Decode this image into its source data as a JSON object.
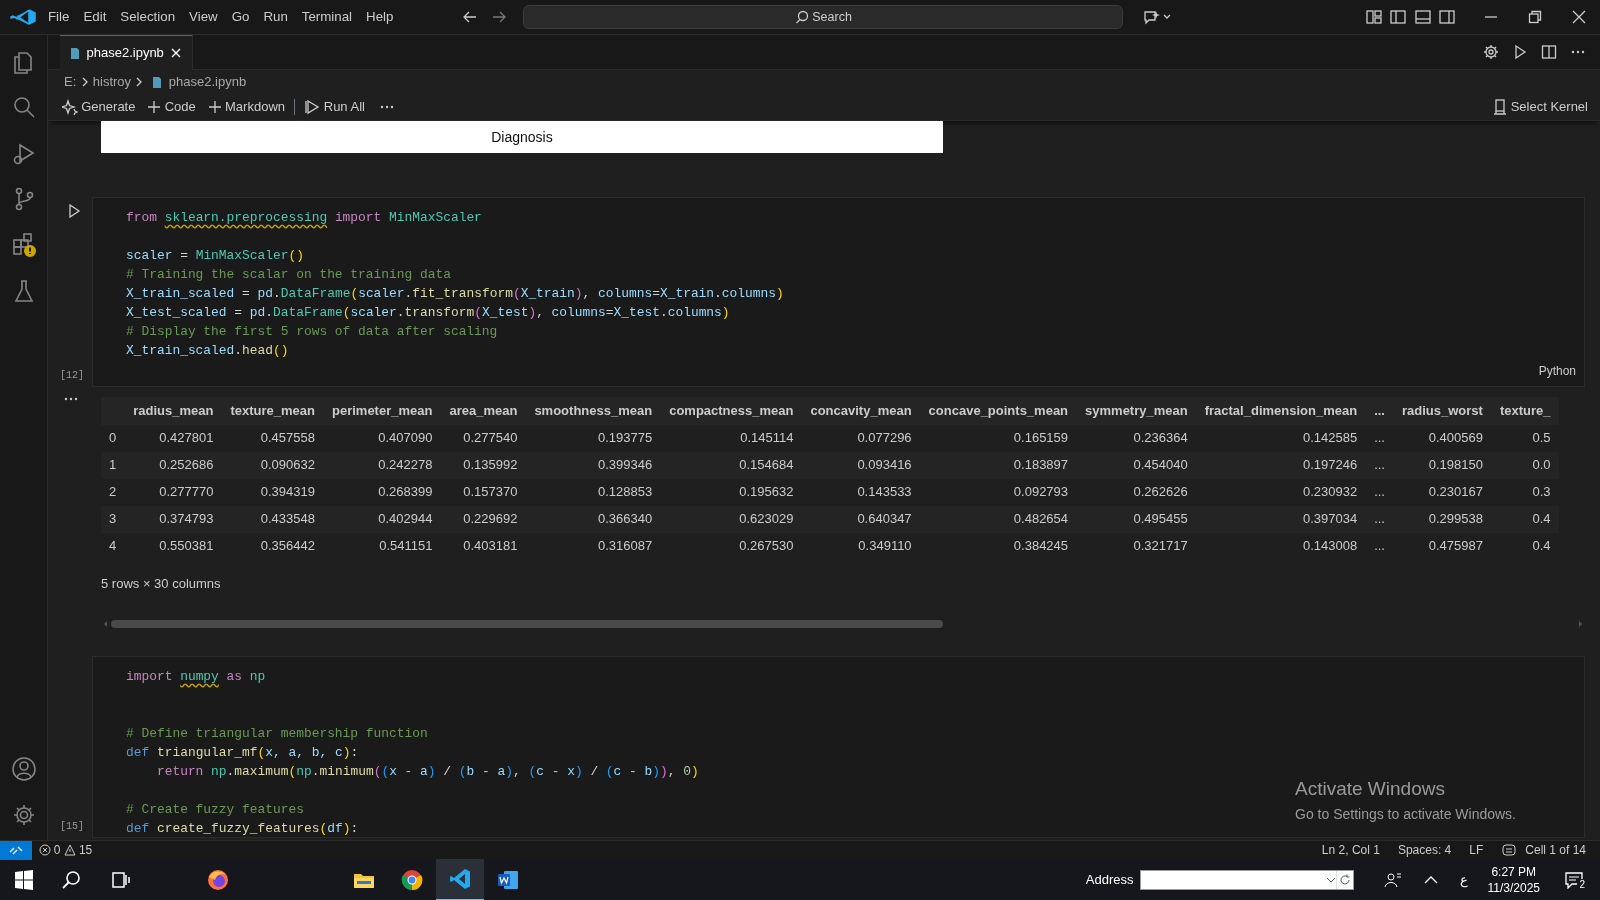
{
  "menu": [
    "File",
    "Edit",
    "Selection",
    "View",
    "Go",
    "Run",
    "Terminal",
    "Help"
  ],
  "search": {
    "placeholder": "Search"
  },
  "editor_tabs": [
    {
      "label": "phase2.ipynb",
      "selected": true
    }
  ],
  "breadcrumb": [
    "E:",
    "histroy",
    "phase2.ipynb"
  ],
  "notebook_toolbar": [
    {
      "label": "Generate",
      "kind": "sparkle"
    },
    {
      "label": "Code",
      "kind": "plus"
    },
    {
      "label": "Markdown",
      "kind": "plus"
    },
    {
      "label": "Run All",
      "kind": "run"
    }
  ],
  "kernel": {
    "label": "Select Kernel"
  },
  "plot_fragment": {
    "label": "Diagnosis"
  },
  "cells": [
    {
      "execution_count": "[12]",
      "language": "Python",
      "lines": [
        {
          "segments": [
            {
              "t": "from ",
              "kind": "keyword"
            },
            {
              "t": "sklearn.preprocessing",
              "kind": "module",
              "squiggle": true
            },
            {
              "t": " import ",
              "kind": "keyword"
            },
            {
              "t": "MinMaxScaler",
              "kind": "module"
            }
          ]
        },
        {
          "kind": "spaced",
          "segments": [
            {
              "t": "scaler",
              "kind": "variable"
            },
            {
              "t": " = ",
              "kind": "plain"
            },
            {
              "t": "MinMaxScaler",
              "kind": "module"
            },
            {
              "t": "()",
              "kind": "bracket"
            }
          ]
        },
        {
          "segments": [
            {
              "t": "# Training the scalar on the training data",
              "kind": "comment"
            }
          ]
        },
        {
          "segments": [
            {
              "t": "X_train_scaled",
              "kind": "variable"
            },
            {
              "t": " = ",
              "kind": "plain"
            },
            {
              "t": "pd",
              "kind": "variable"
            },
            {
              "t": ".",
              "kind": "plain"
            },
            {
              "t": "DataFrame",
              "kind": "module"
            },
            {
              "t": "(",
              "kind": "bracket"
            },
            {
              "t": "scaler",
              "kind": "variable"
            },
            {
              "t": ".",
              "kind": "plain"
            },
            {
              "t": "fit_transform",
              "kind": "function"
            },
            {
              "t": "(",
              "kind": "bracket2"
            },
            {
              "t": "X_train",
              "kind": "variable"
            },
            {
              "t": ")",
              "kind": "bracket2"
            },
            {
              "t": ", ",
              "kind": "plain"
            },
            {
              "t": "columns",
              "kind": "variable"
            },
            {
              "t": "=",
              "kind": "plain"
            },
            {
              "t": "X_train",
              "kind": "variable"
            },
            {
              "t": ".",
              "kind": "plain"
            },
            {
              "t": "columns",
              "kind": "variable"
            },
            {
              "t": ")",
              "kind": "bracket"
            }
          ]
        },
        {
          "segments": [
            {
              "t": "X_test_scaled",
              "kind": "variable"
            },
            {
              "t": " = ",
              "kind": "plain"
            },
            {
              "t": "pd",
              "kind": "variable"
            },
            {
              "t": ".",
              "kind": "plain"
            },
            {
              "t": "DataFrame",
              "kind": "module"
            },
            {
              "t": "(",
              "kind": "bracket"
            },
            {
              "t": "scaler",
              "kind": "variable"
            },
            {
              "t": ".",
              "kind": "plain"
            },
            {
              "t": "transform",
              "kind": "function"
            },
            {
              "t": "(",
              "kind": "bracket2"
            },
            {
              "t": "X_test",
              "kind": "variable"
            },
            {
              "t": ")",
              "kind": "bracket2"
            },
            {
              "t": ", ",
              "kind": "plain"
            },
            {
              "t": "columns",
              "kind": "variable"
            },
            {
              "t": "=",
              "kind": "plain"
            },
            {
              "t": "X_test",
              "kind": "variable"
            },
            {
              "t": ".",
              "kind": "plain"
            },
            {
              "t": "columns",
              "kind": "variable"
            },
            {
              "t": ")",
              "kind": "bracket"
            }
          ]
        },
        {
          "segments": [
            {
              "t": "# Display the first 5 rows of data after scaling",
              "kind": "comment"
            }
          ]
        },
        {
          "segments": [
            {
              "t": "X_train_scaled",
              "kind": "variable"
            },
            {
              "t": ".",
              "kind": "plain"
            },
            {
              "t": "head",
              "kind": "function"
            },
            {
              "t": "()",
              "kind": "bracket"
            }
          ]
        }
      ],
      "output": {
        "columns": [
          "radius_mean",
          "texture_mean",
          "perimeter_mean",
          "area_mean",
          "smoothness_mean",
          "compactness_mean",
          "concavity_mean",
          "concave_points_mean",
          "symmetry_mean",
          "fractal_dimension_mean",
          "...",
          "radius_worst",
          "texture_"
        ],
        "rows": [
          {
            "index": "0",
            "cells": [
              "0.427801",
              "0.457558",
              "0.407090",
              "0.277540",
              "0.193775",
              "0.145114",
              "0.077296",
              "0.165159",
              "0.236364",
              "0.142585",
              "...",
              "0.400569",
              "0.5"
            ]
          },
          {
            "index": "1",
            "cells": [
              "0.252686",
              "0.090632",
              "0.242278",
              "0.135992",
              "0.399346",
              "0.154684",
              "0.093416",
              "0.183897",
              "0.454040",
              "0.197246",
              "...",
              "0.198150",
              "0.0"
            ]
          },
          {
            "index": "2",
            "cells": [
              "0.277770",
              "0.394319",
              "0.268399",
              "0.157370",
              "0.128853",
              "0.195632",
              "0.143533",
              "0.092793",
              "0.262626",
              "0.230932",
              "...",
              "0.230167",
              "0.3"
            ]
          },
          {
            "index": "3",
            "cells": [
              "0.374793",
              "0.433548",
              "0.402944",
              "0.229692",
              "0.366340",
              "0.623029",
              "0.640347",
              "0.482654",
              "0.495455",
              "0.397034",
              "...",
              "0.299538",
              "0.4"
            ]
          },
          {
            "index": "4",
            "cells": [
              "0.550381",
              "0.356442",
              "0.541151",
              "0.403181",
              "0.316087",
              "0.267530",
              "0.349110",
              "0.384245",
              "0.321717",
              "0.143008",
              "...",
              "0.475987",
              "0.4"
            ]
          }
        ],
        "summary": "5 rows × 30 columns"
      }
    },
    {
      "execution_count": "[15]",
      "lines": [
        {
          "segments": [
            {
              "t": "import ",
              "kind": "keyword"
            },
            {
              "t": "numpy",
              "kind": "module",
              "squiggle": true
            },
            {
              "t": " as ",
              "kind": "keyword"
            },
            {
              "t": "np",
              "kind": "module"
            }
          ]
        },
        {
          "kind": "doublespaced",
          "segments": [
            {
              "t": "# Define triangular membership function",
              "kind": "comment"
            }
          ]
        },
        {
          "segments": [
            {
              "t": "def ",
              "kind": "declaration"
            },
            {
              "t": "triangular_mf",
              "kind": "function"
            },
            {
              "t": "(",
              "kind": "bracket"
            },
            {
              "t": "x, a, b, c",
              "kind": "variable"
            },
            {
              "t": ")",
              "kind": "bracket"
            },
            {
              "t": ":",
              "kind": "plain"
            }
          ]
        },
        {
          "segments": [
            {
              "t": "    return ",
              "kind": "keyword"
            },
            {
              "t": "np",
              "kind": "module"
            },
            {
              "t": ".",
              "kind": "plain"
            },
            {
              "t": "maximum",
              "kind": "function"
            },
            {
              "t": "(",
              "kind": "bracket"
            },
            {
              "t": "np",
              "kind": "module"
            },
            {
              "t": ".",
              "kind": "plain"
            },
            {
              "t": "minimum",
              "kind": "function"
            },
            {
              "t": "(",
              "kind": "bracket2"
            },
            {
              "t": "(",
              "kind": "bracket3"
            },
            {
              "t": "x - a",
              "kind": "variable"
            },
            {
              "t": ")",
              "kind": "bracket3"
            },
            {
              "t": " / ",
              "kind": "plain"
            },
            {
              "t": "(",
              "kind": "bracket3"
            },
            {
              "t": "b - a",
              "kind": "variable"
            },
            {
              "t": ")",
              "kind": "bracket3"
            },
            {
              "t": ", ",
              "kind": "plain"
            },
            {
              "t": "(",
              "kind": "bracket3"
            },
            {
              "t": "c - x",
              "kind": "variable"
            },
            {
              "t": ")",
              "kind": "bracket3"
            },
            {
              "t": " / ",
              "kind": "plain"
            },
            {
              "t": "(",
              "kind": "bracket3"
            },
            {
              "t": "c - b",
              "kind": "variable"
            },
            {
              "t": ")",
              "kind": "bracket3"
            },
            {
              "t": ")",
              "kind": "bracket2"
            },
            {
              "t": ", ",
              "kind": "plain"
            },
            {
              "t": "0",
              "kind": "number"
            },
            {
              "t": ")",
              "kind": "bracket"
            }
          ]
        },
        {
          "kind": "spaced",
          "segments": [
            {
              "t": "# Create fuzzy features",
              "kind": "comment"
            }
          ]
        },
        {
          "segments": [
            {
              "t": "def ",
              "kind": "declaration"
            },
            {
              "t": "create_fuzzy_features",
              "kind": "function"
            },
            {
              "t": "(",
              "kind": "bracket"
            },
            {
              "t": "df",
              "kind": "variable"
            },
            {
              "t": ")",
              "kind": "bracket"
            },
            {
              "t": ":",
              "kind": "plain"
            }
          ]
        }
      ]
    }
  ],
  "activation_notice": {
    "title": "Activate Windows",
    "text": "Go to Settings to activate Windows."
  },
  "status_bar": {
    "errors": "0",
    "warnings": "15",
    "items": [
      "Ln 2, Col 1",
      "Spaces: 4",
      "LF",
      "Cell 1 of 14"
    ]
  },
  "taskbar": {
    "apps": [
      {
        "kind": "firefox",
        "selected": false
      },
      {
        "kind": "explorer",
        "selected": false
      },
      {
        "kind": "chrome",
        "selected": false
      },
      {
        "kind": "vscode",
        "selected": true
      },
      {
        "kind": "word",
        "selected": false
      }
    ],
    "address_label": "Address",
    "language": "ع",
    "time": "6:27 PM",
    "date": "11/3/2025",
    "notifications": "2"
  }
}
